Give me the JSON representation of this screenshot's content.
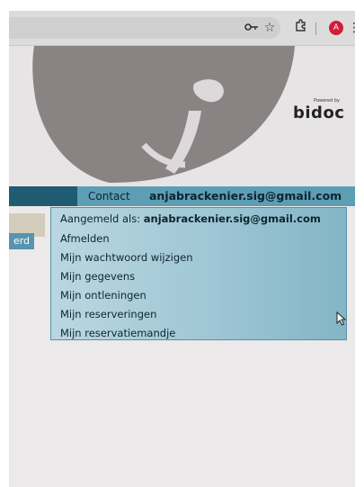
{
  "browser": {
    "profile_initial": "A",
    "icons": [
      "key-icon",
      "star-icon",
      "puzzle-icon",
      "menu-icon"
    ]
  },
  "banner": {
    "powered_by": "Powered by",
    "logo_text": "bidoc"
  },
  "nav": {
    "contact_label": "Contact",
    "user_email": "anjabrackenier.sig@gmail.com"
  },
  "side": {
    "button_text": "erd"
  },
  "dropdown": {
    "signed_in_label": "Aangemeld als:",
    "signed_in_email": "anjabrackenier.sig@gmail.com",
    "items": [
      "Afmelden",
      "Mijn wachtwoord wijzigen",
      "Mijn gegevens",
      "Mijn ontleningen",
      "Mijn reserveringen",
      "Mijn reservatiemandje"
    ]
  },
  "colors": {
    "nav_dark": "#1f5c72",
    "nav_contact": "#5d9eb4",
    "dropdown_bg": "#a8ccd8",
    "profile_red": "#cf1d3a"
  }
}
